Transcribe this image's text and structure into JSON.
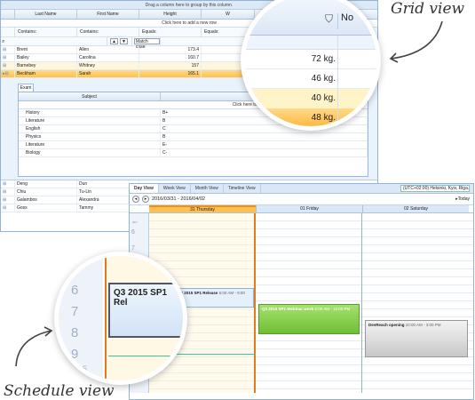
{
  "captions": {
    "grid_view": "Grid view",
    "schedule_view": "Schedule view"
  },
  "grid": {
    "group_panel": "Drag a column here to group by this column.",
    "columns": [
      "Last Name",
      "First Name",
      "Height",
      "W"
    ],
    "add_row": "Click here to add a new row",
    "filters": [
      "Contains:",
      "Contains:",
      "Equals:",
      "Equals:"
    ],
    "match_case": "Match case",
    "rows": [
      [
        "Brent",
        "Allen",
        "173.4"
      ],
      [
        "Bailey",
        "Carolina",
        "160.7"
      ],
      [
        "Barnebey",
        "Whitney",
        "157"
      ],
      [
        "Beckham",
        "Sarah",
        "165.1"
      ]
    ],
    "rows2": [
      [
        "Deng",
        "Dun"
      ],
      [
        "Chiu",
        "Tu-Lin"
      ],
      [
        "Galambos",
        "Alexandra"
      ],
      [
        "Goss",
        "Tammy"
      ]
    ],
    "detail": {
      "tab": "Exam",
      "col_subject": "Subject",
      "col_grade": "Gra",
      "add_row": "Click here to add a new row",
      "rows": [
        [
          "History",
          "B+"
        ],
        [
          "Literature",
          "B"
        ],
        [
          "English",
          "C"
        ],
        [
          "Physics",
          "B"
        ],
        [
          "Literature",
          "E-"
        ],
        [
          "Biology",
          "C-"
        ]
      ]
    }
  },
  "grid_magnifier": {
    "column_label": "No",
    "values": [
      "72 kg.",
      "46 kg.",
      "40 kg.",
      "48 kg."
    ]
  },
  "schedule": {
    "tabs": [
      "Day View",
      "Week View",
      "Month View",
      "Timeline View"
    ],
    "timezone": "(UTC+02:00) Helsinki, Kyiv, Riga..",
    "date_range": "2016/03/31 - 2016/04/02",
    "today": "Today",
    "days": [
      "31 Thursday",
      "01 Friday",
      "02 Saturday"
    ],
    "appointments": {
      "q3_title": "Q3 2015 SP1 Release",
      "q3_time": "6:00 AM - 9:00 AM",
      "webinar_title": "Q3 2015 SP1 Webinar week",
      "webinar_time": "8:00 AM - 12:00 PM",
      "devreach_title": "DevReach opening",
      "devreach_time": "10:00 AM - 3:00 PM"
    },
    "hours": [
      "6",
      "7",
      "8",
      "9",
      "10",
      "11",
      "12",
      "13",
      "14",
      "15",
      "16"
    ],
    "am_label": "am"
  },
  "schedule_magnifier": {
    "appt_text": "Q3 2015 SP1 Rel",
    "hours": [
      "6",
      "7",
      "8",
      "9"
    ],
    "year_label": "2015"
  }
}
